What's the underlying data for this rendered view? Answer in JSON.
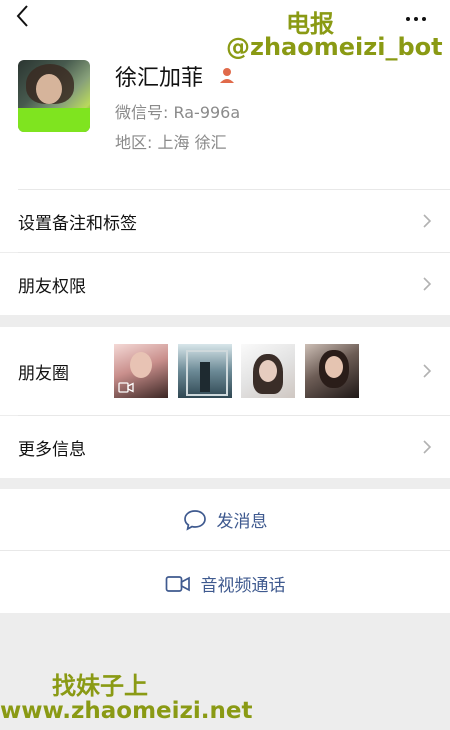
{
  "watermark": {
    "top_line1": "电报",
    "top_line2": "@zhaomeizi_bot",
    "bottom_line1": "找妹子上",
    "bottom_line2": "www.zhaomeizi.net"
  },
  "profile": {
    "name": "徐汇加菲",
    "wechat_id": "微信号: Ra-996a",
    "region": "地区: 上海  徐汇"
  },
  "rows": {
    "remark_label": "设置备注和标签",
    "permissions_label": "朋友权限",
    "moments_label": "朋友圈",
    "more_info_label": "更多信息"
  },
  "actions": {
    "message_label": "发消息",
    "call_label": "音视频通话"
  },
  "colors": {
    "accent_link": "#3f5a8f",
    "watermark": "#8a9a14",
    "badge": "#e06a4a"
  },
  "icons": [
    "back-icon",
    "more-icon",
    "person-icon",
    "chevron-right-icon",
    "chat-bubble-icon",
    "video-camera-icon"
  ]
}
